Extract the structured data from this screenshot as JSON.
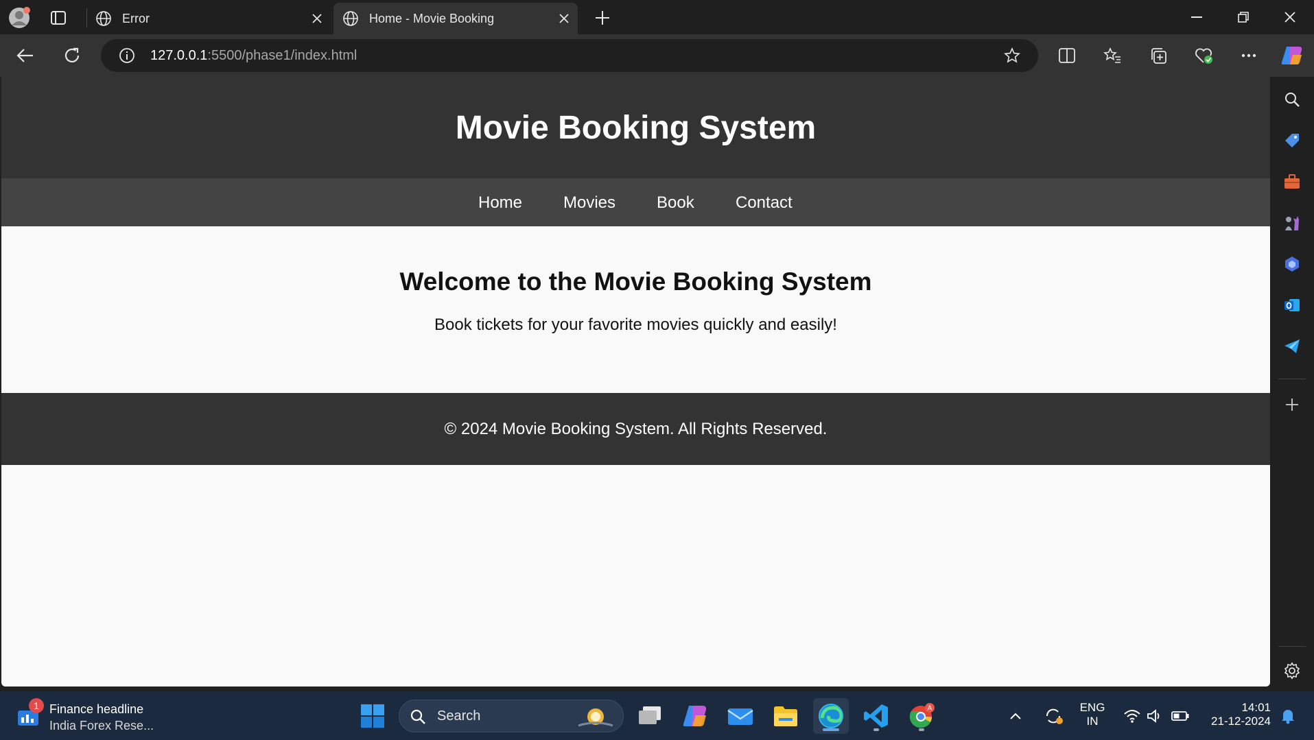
{
  "browser": {
    "tabs": [
      {
        "title": "Error"
      },
      {
        "title": "Home - Movie Booking"
      }
    ],
    "url": {
      "host": "127.0.0.1",
      "rest": ":5500/phase1/index.html"
    }
  },
  "page": {
    "header": {
      "title": "Movie Booking System"
    },
    "nav": [
      "Home",
      "Movies",
      "Book",
      "Contact"
    ],
    "main": {
      "heading": "Welcome to the Movie Booking System",
      "tagline": "Book tickets for your favorite movies quickly and easily!"
    },
    "footer": {
      "text": "© 2024 Movie Booking System. All Rights Reserved."
    }
  },
  "taskbar": {
    "widget": {
      "title": "Finance headline",
      "subtitle": "India Forex Rese...",
      "badge": "1"
    },
    "search_label": "Search",
    "tray": {
      "lang1": "ENG",
      "lang2": "IN",
      "time": "14:01",
      "date": "21-12-2024"
    }
  },
  "icons": {
    "colors": {
      "accent": "#0078d4",
      "edge": "#2fb8e8",
      "vscode": "#23a0f0"
    }
  }
}
